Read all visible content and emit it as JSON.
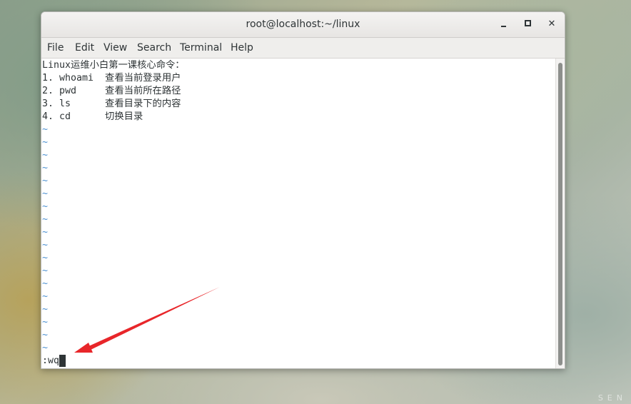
{
  "window": {
    "title": "root@localhost:~/linux",
    "minimize_icon": "minimize-icon",
    "maximize_icon": "maximize-icon",
    "close_label": "✕"
  },
  "menu": {
    "items": [
      "File",
      "Edit",
      "View",
      "Search",
      "Terminal",
      "Help"
    ]
  },
  "terminal": {
    "lines": [
      "Linux运维小白第一课核心命令：",
      "1. whoami  查看当前登录用户",
      "2. pwd     查看当前所在路径",
      "3. ls      查看目录下的内容",
      "4. cd      切换目录"
    ],
    "tilde": "~",
    "tilde_rows": 18,
    "command": ":wq"
  },
  "background": {
    "mark": "SEN"
  },
  "colors": {
    "annotation_arrow": "#e8262a",
    "tilde": "#4a8fd1",
    "text": "#2e3436"
  }
}
